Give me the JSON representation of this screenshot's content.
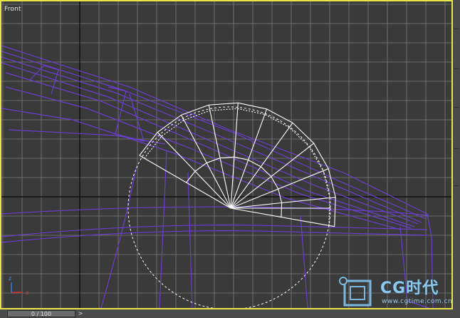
{
  "viewport": {
    "label": "Front",
    "border_color": "#e6e64a",
    "grid_color": "#7a7a7a",
    "axis_color": "#111111"
  },
  "scene": {
    "wire_color": "#6a3ecf",
    "object_color": "#ffffff",
    "gizmo": "rotate-gizmo"
  },
  "axis_tripod": {
    "x_label": "x",
    "z_label": "z"
  },
  "timeline": {
    "frame_readout": "0 / 100",
    "next_label": ">"
  },
  "watermark": {
    "brand": "CG时代",
    "url": "www.cgtime.com.cn",
    "icon": "cgtime-logo-icon"
  }
}
